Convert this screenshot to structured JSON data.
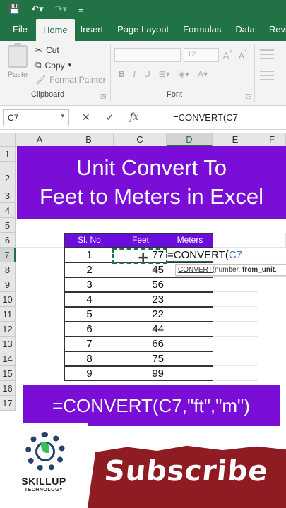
{
  "ribbon": {
    "tabs": [
      "File",
      "Home",
      "Insert",
      "Page Layout",
      "Formulas",
      "Data",
      "Revi"
    ],
    "active_tab": "Home",
    "clipboard": {
      "paste": "Paste",
      "cut": "Cut",
      "copy": "Copy",
      "format_painter": "Format Painter",
      "group_label": "Clipboard"
    },
    "font": {
      "size": "12",
      "group_label": "Font",
      "bold": "B",
      "italic": "I",
      "underline": "U"
    }
  },
  "formula_bar": {
    "name_box": "C7",
    "formula": "=CONVERT(C7",
    "cancel": "✕",
    "enter": "✓",
    "fx": "fx"
  },
  "columns": [
    "A",
    "B",
    "C",
    "D",
    "E",
    "F"
  ],
  "rows": [
    "1",
    "2",
    "3",
    "4",
    "5",
    "6",
    "7",
    "8",
    "9",
    "10",
    "11",
    "12",
    "13",
    "14",
    "15",
    "16",
    "17"
  ],
  "table": {
    "headers": [
      "Sl. No",
      "Feet",
      "Meters"
    ],
    "rows": [
      [
        "1",
        "77"
      ],
      [
        "2",
        "45"
      ],
      [
        "3",
        "56"
      ],
      [
        "4",
        "23"
      ],
      [
        "5",
        "22"
      ],
      [
        "6",
        "44"
      ],
      [
        "7",
        "66"
      ],
      [
        "8",
        "75"
      ],
      [
        "9",
        "99"
      ]
    ]
  },
  "editing": {
    "prefix": "=CONVERT(",
    "ref": "C7"
  },
  "tooltip": {
    "fn": "CONVERT(",
    "args": "number, ",
    "bold_arg": "from_unit",
    "tail": ", "
  },
  "overlay": {
    "title_line1": "Unit Convert To",
    "title_line2": "Feet to Meters in Excel",
    "formula": "=CONVERT(C7,\"ft\",\"m\")"
  },
  "branding": {
    "name": "SKILLUP",
    "tagline": "TECHNOLOGY",
    "subscribe": "Subscribe"
  },
  "colors": {
    "excel_green": "#217346",
    "purple": "#7a0ed6",
    "table_header": "#6a0dde",
    "subscribe_red": "#8f1c23"
  }
}
